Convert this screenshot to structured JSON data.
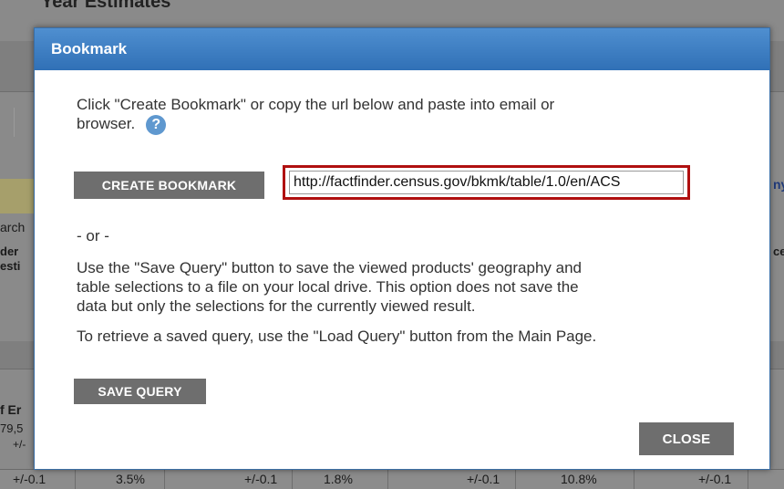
{
  "background": {
    "partial_heading": "Year Estimates",
    "left_fragments": [
      "arch",
      "der",
      "esti",
      "f Er",
      "79,5",
      "+/-"
    ],
    "right_fragments": [
      "ny",
      "ce"
    ],
    "bottom_row": [
      "+/-0.1",
      "3.5%",
      "+/-0.1",
      "1.8%",
      "+/-0.1",
      "10.8%",
      "+/-0.1"
    ]
  },
  "dialog": {
    "title": "Bookmark",
    "intro_line1": "Click \"Create Bookmark\" or copy the url below and paste into email or",
    "intro_line2": "browser.",
    "help_icon_glyph": "?",
    "create_bookmark_label": "CREATE BOOKMARK",
    "url_value": "http://factfinder.census.gov/bkmk/table/1.0/en/ACS",
    "or_text": "- or -",
    "save_info_line1": "Use the \"Save Query\" button to save the viewed products' geography and",
    "save_info_line2": "table selections to a file on your local drive. This option does not save the",
    "save_info_line3": "data but only the selections for the currently viewed result.",
    "retrieve_text": "To retrieve a saved query, use the \"Load Query\" button from the Main Page.",
    "save_query_label": "SAVE QUERY",
    "close_label": "CLOSE"
  },
  "colors": {
    "header_blue": "#3070b6",
    "button_gray": "#6e6e6e",
    "highlight_red": "#b01010",
    "help_icon_blue": "#5f98cf"
  },
  "icons": {
    "help": "question-circle-icon"
  }
}
